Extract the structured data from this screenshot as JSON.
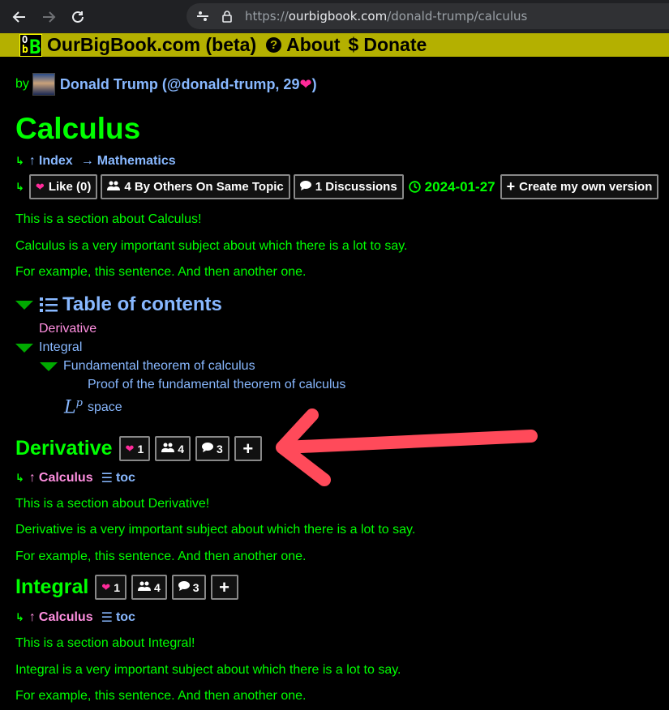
{
  "browser": {
    "url_scheme": "https://",
    "url_host": "ourbigbook.com",
    "url_path": "/donald-trump/calculus"
  },
  "sitenav": {
    "logo_text_top": "O",
    "logo_text_bottom": "b",
    "logo_text_big": "B",
    "brand": "OurBigBook.com (beta)",
    "about_icon": "?",
    "about": "About",
    "donate_icon": "$",
    "donate": "Donate"
  },
  "byline": {
    "prefix": "by",
    "author": "Donald Trump (@donald-trump, 29",
    "heart": "❤",
    "suffix": ")"
  },
  "page": {
    "title": "Calculus",
    "crumbs": {
      "index": "Index",
      "parent": "Mathematics"
    },
    "like_label": "Like (0)",
    "others_label": "4 By Others On Same Topic",
    "discussions_label": "1 Discussions",
    "date": "2024-01-27",
    "create_label": "Create my own version",
    "paragraphs": [
      "This is a section about Calculus!",
      "Calculus is a very important subject about which there is a lot to say.",
      "For example, this sentence. And then another one."
    ]
  },
  "toc": {
    "title": "Table of contents",
    "items": [
      "Derivative",
      "Integral",
      "Fundamental theorem of calculus",
      "Proof of the fundamental theorem of calculus",
      "space"
    ],
    "lp_symbol": "L",
    "lp_sup": "p"
  },
  "sections": [
    {
      "title": "Derivative",
      "likes": "1",
      "others": "4",
      "discussions": "3",
      "add": "+",
      "parent": "Calculus",
      "toc_link": "toc",
      "paragraphs": [
        "This is a section about Derivative!",
        "Derivative is a very important subject about which there is a lot to say.",
        "For example, this sentence. And then another one."
      ]
    },
    {
      "title": "Integral",
      "likes": "1",
      "others": "4",
      "discussions": "3",
      "add": "+",
      "parent": "Calculus",
      "toc_link": "toc",
      "paragraphs": [
        "This is a section about Integral!",
        "Integral is a very important subject about which there is a lot to say.",
        "For example, this sentence. And then another one."
      ]
    }
  ],
  "colors": {
    "text": "#00ff00",
    "link": "#88b8ff",
    "link_visited": "#ff8fe0",
    "nav_bg": "#b4b000",
    "heart": "#ff2a9a",
    "annotation_arrow": "#ff4a5a"
  }
}
